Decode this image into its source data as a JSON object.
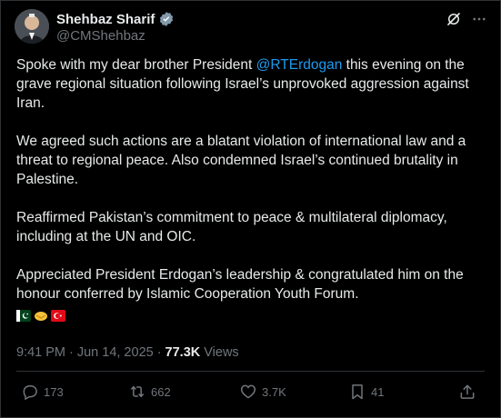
{
  "author": {
    "name": "Shehbaz Sharif",
    "handle": "@CMShehbaz",
    "verified_icon": "verified-badge-icon"
  },
  "tweet": {
    "paragraphs": [
      {
        "before": "Spoke with my dear brother President ",
        "mention": "@RTErdogan",
        "after": " this evening on the grave regional situation following Israel’s unprovoked aggression against Iran."
      },
      {
        "text": "We agreed such actions are a blatant violation of international law and a threat to regional peace. Also condemned Israel’s continued brutality in Palestine."
      },
      {
        "text": "Reaffirmed Pakistan’s commitment to peace & multilateral diplomacy, including at the UN and OIC."
      },
      {
        "text": "Appreciated President Erdogan’s leadership & congratulated him on the honour conferred by Islamic Cooperation Youth Forum."
      }
    ],
    "emojis": [
      "pakistan-flag",
      "handshake",
      "turkey-flag"
    ]
  },
  "meta": {
    "time": "9:41 PM",
    "separator": "·",
    "date": "Jun 14, 2025",
    "views_count": "77.3K",
    "views_label": "Views"
  },
  "actions": {
    "replies": "173",
    "reposts": "662",
    "likes": "3.7K",
    "bookmarks": "41"
  },
  "colors": {
    "background": "#000000",
    "text": "#e7e9ea",
    "secondary": "#71767b",
    "accent": "#1d9bf0"
  }
}
